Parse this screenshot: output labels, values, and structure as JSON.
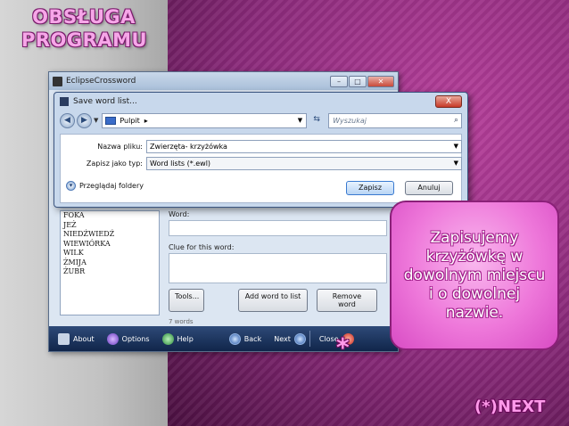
{
  "slide": {
    "title_line1": "OBSŁUGA",
    "title_line2": "PROGRAMU",
    "callout_text": "Zapisujemy krzyżówkę w dowolnym miejscu i o dowolnej nazwie.",
    "star": "*",
    "next_link": "(*)NEXT"
  },
  "app": {
    "title": "EclipseCrossword",
    "word_list": [
      "FOKA",
      "JEŻ",
      "NIEDŹWIEDŹ",
      "WIEWIÓRKA",
      "WILK",
      "ŻMIJA",
      "ŻUBR"
    ],
    "word_label": "Word:",
    "clue_label": "Clue for this word:",
    "tools_button": "Tools...",
    "add_word_button": "Add word to list",
    "remove_word_button": "Remove word",
    "words_count": "7 words",
    "bottom_bar": {
      "about": "About",
      "options": "Options",
      "help": "Help",
      "back": "Back",
      "next": "Next",
      "close": "Close"
    }
  },
  "dialog": {
    "title": "Save word list...",
    "close_glyph": "X",
    "location": "Pulpit",
    "search_placeholder": "Wyszukaj",
    "file_name_label": "Nazwa pliku:",
    "file_name_value": "Zwierzęta- krzyżówka",
    "save_type_label": "Zapisz jako typ:",
    "save_type_value": "Word lists (*.ewl)",
    "browse_folders": "Przeglądaj foldery",
    "save_button": "Zapisz",
    "cancel_button": "Anuluj"
  },
  "colors": {
    "slide_accent": "#ff9aea",
    "callout_fill": "#ee78da",
    "app_toolbar": "#10254a"
  }
}
